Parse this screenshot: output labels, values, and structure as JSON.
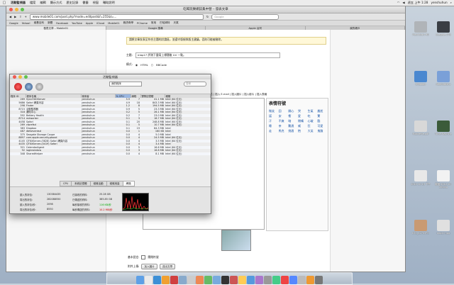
{
  "menubar": {
    "apple": "",
    "items": [
      "如果",
      "檔案",
      "編輯",
      "顯示方式",
      "歷史記錄",
      "書籤",
      "視窗",
      "輔助說明"
    ],
    "app": "活動監視器",
    "clock": "週五 上午 1:28",
    "user": "yenshuhun"
  },
  "browser": {
    "title": "吃喝玩樂網誌集中營 – 發表文章",
    "url": "www.mobile01.com/post.php?mode=editpost&f=255&t=...",
    "google_placeholder": "Google",
    "bookmarks": [
      "Google",
      "Yahoo!",
      "維基百科",
      "新聞",
      "Facebook",
      "YouTube",
      "Apple",
      "iCloud",
      "Mobile01",
      "雅虎奇摩",
      "PChome",
      "常用",
      "巴哈姆特",
      "天氣"
    ],
    "tabs": [
      "發表文章 – Mobile01",
      "Google 搜尋",
      "Apple 台灣",
      "我的帳戶"
    ]
  },
  "page": {
    "notice": "請將文章发表至符合主題的討論區，並遵守版規與版主建議，否則可能被刪除。",
    "subject_label": "主題:",
    "subject_value": "mbp17 評測下載寫上標題後 Uri 一點。",
    "mode_label": "模式:",
    "mode_html": "HTML",
    "mode_bbcode": "BBCode",
    "text_style_label": "文字樣式",
    "editor_toolbar": "寬化字 | 斜體字 | 加底線 | 文字顏色 | 插入連結 | 插入 E-mail | 插入圖片 | 插入影片 | 插入表格",
    "editor_text": "...ch/201210/mobile01-\n...g\">",
    "emoticons_title": "表情符號",
    "emoticons": [
      "微笑",
      "囧",
      "開心",
      "哭",
      "生氣",
      "尷尬",
      "諾",
      "安",
      "衝",
      "愛",
      "吃",
      "驚",
      "汗",
      "不爽",
      "暗",
      "閉嘴",
      "心破",
      "酷",
      "睡",
      "亲",
      "難過",
      "威",
      "狂",
      "可愛",
      "走",
      "馬克",
      "挑眉",
      "抱",
      "大笑",
      "鬼臉"
    ],
    "attach_label": "加入圖片",
    "checkbox1_label": "基本設定:",
    "checkbox1_value": "關閉符號",
    "checkbox2_label": "附件上傳:",
    "submit": "送出文章"
  },
  "activity_monitor": {
    "title": "活動監視器",
    "filter": "我的程序",
    "search_placeholder": "搜尋",
    "columns": [
      "程序 ID",
      "程序名稱",
      "使用者",
      "% CPU",
      "線程",
      "實際記憶體",
      "種類"
    ],
    "rows": [
      [
        "269",
        "SyncHUDServer",
        "yenshuhun",
        "5.9",
        "7",
        "41.1 MB",
        "Intel (64 位元)"
      ],
      [
        "5686",
        "Safari 網頁內容",
        "yenshuhun",
        "4.9",
        "18",
        "843.3 MB",
        "Intel (64 位元)"
      ],
      [
        "298",
        "Finder",
        "yenshuhun",
        "1.2",
        "8",
        "194.5 MB",
        "Intel (64 位元)"
      ],
      [
        "8715",
        "活動監視器",
        "yenshuhun",
        "0.9",
        "5",
        "23.3 MB",
        "Intel (64 位元)"
      ],
      [
        "318",
        "通知中心",
        "yenshuhun",
        "0.2",
        "5",
        "26.1 MB",
        "Intel (64 位元)"
      ],
      [
        "592",
        "Bettery Health",
        "yenshuhun",
        "0.2",
        "7",
        "23.0 MB",
        "Intel (64 位元)"
      ],
      [
        "8714",
        "mdworker",
        "yenshuhun",
        "0.1",
        "3",
        "18.7 MB",
        "Intel (64 位元)"
      ],
      [
        "4458",
        "Safari",
        "yenshuhun",
        "0.1",
        "20",
        "248.8 MB",
        "Intel (64 位元)"
      ],
      [
        "269",
        "cfprefsd",
        "yenshuhun",
        "0.1",
        "5",
        "10.7 MB",
        "Intel (64 位元)"
      ],
      [
        "383",
        "Dropbox",
        "yenshuhun",
        "0.1",
        "19",
        "84.3 MB",
        "Intel"
      ],
      [
        "487",
        "dbfseventsd",
        "yenshuhun",
        "0.0",
        "1",
        "160 KB",
        "Intel"
      ],
      [
        "375",
        "Seagate Storage Coupe",
        "yenshuhun",
        "0.0",
        "4",
        "5.0 MB",
        "Intel"
      ],
      [
        "8897",
        "com.apple.security.pboxd",
        "yenshuhun",
        "0.0",
        "4",
        "24.5 MB",
        "Intel (64 位元)"
      ],
      [
        "4145",
        "QTKitServer-(5828) Safari 網頁內容",
        "yenshuhun",
        "0.0",
        "4",
        "3.5 MB",
        "Intel (64 位元)"
      ],
      [
        "4435",
        "QTKitServer-(4419) Safari",
        "yenshuhun",
        "0.0",
        "4",
        "3.4 MB",
        "Intel"
      ],
      [
        "321",
        "CalendarAgent",
        "yenshuhun",
        "0.0",
        "5",
        "16.6 MB",
        "Intel (64 位元)"
      ],
      [
        "92",
        "loginwindow",
        "yenshuhun",
        "0.0",
        "3",
        "16.8 MB",
        "Intel (64 位元)"
      ],
      [
        "348",
        "SharedHelper",
        "yenshuhun",
        "0.0",
        "4",
        "8.1 MB",
        "Intel (64 位元)"
      ]
    ],
    "tabs": [
      "CPU",
      "系統記憶體",
      "磁碟活動",
      "磁碟用量",
      "網路"
    ],
    "stats": {
      "read_in_label": "讀入的封包:",
      "read_in": "130384435",
      "written_out_label": "寫出的封包:",
      "written_out": "282088550",
      "read_sec_label": "讀入的封包/秒:",
      "read_sec": "2098",
      "write_sec_label": "寫出的封包/秒:",
      "write_sec": "8550",
      "data_in_label": "已接收的資料:",
      "data_in": "25.28 GB",
      "data_out_label": "已傳送的資料:",
      "data_out": "385.85 GB",
      "rate_in_label": "每秒接收的資料:",
      "rate_in": "116 KB/秒",
      "rate_out_label": "每秒傳送的資料:",
      "rate_out": "10.2 MB/秒"
    }
  },
  "desktop_icons": [
    {
      "label": "Macintosh HD",
      "color": "#b0b4b8"
    },
    {
      "label": "Seagate 2TB",
      "color": "#3a3e44"
    },
    {
      "label": "Dropbox",
      "color": "#4a88d0"
    },
    {
      "label": "Applications",
      "color": "#7aa0d8"
    },
    {
      "label": "MobileMe.pdf",
      "color": "#d8d8d8"
    },
    {
      "label": "Time Machine",
      "color": "#3b5b3a"
    },
    {
      "label": "2012-10-19 下午",
      "color": "#e8e8e8"
    },
    {
      "label": "截圖 2012-10-26.png",
      "color": "#f2f2f2"
    },
    {
      "label": "IMG_6270.JPG",
      "color": "#c99a72"
    },
    {
      "label": "mbp17.jpg",
      "color": "#e0e0e0"
    }
  ],
  "dock_colors": [
    "#5ea0e6",
    "#eaeaea",
    "#3b8fd6",
    "#f0a030",
    "#d04040",
    "#8ac",
    "#ccc",
    "#e85",
    "#6b6",
    "#7ad",
    "#333",
    "#c55",
    "#fc5",
    "#59d",
    "#a7c",
    "#999",
    "#4c8",
    "#e44",
    "#58f",
    "#bbb",
    "#e93",
    "#777"
  ]
}
